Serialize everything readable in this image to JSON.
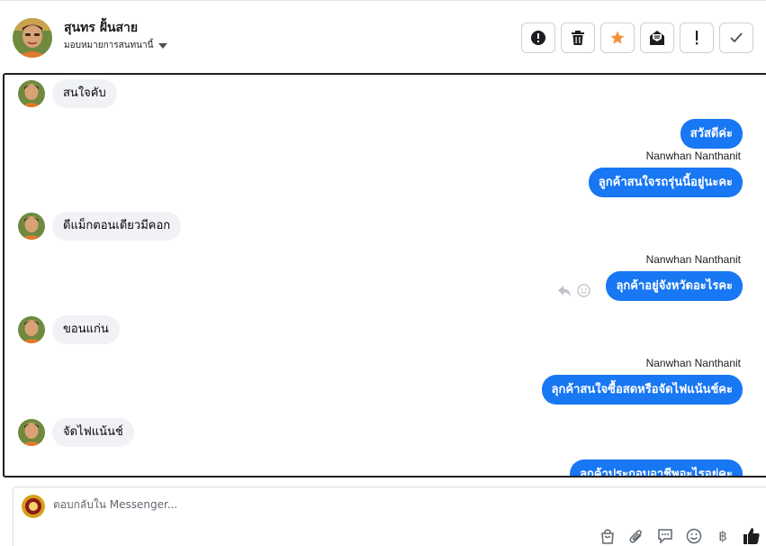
{
  "header": {
    "contact_name": "สุนทร ฝั้นสาย",
    "assign_label": "มอบหมายการสนทนานี้",
    "actions": [
      {
        "name": "spam-button",
        "icon": "alert-circle-icon"
      },
      {
        "name": "delete-button",
        "icon": "trash-icon"
      },
      {
        "name": "star-button",
        "icon": "star-icon"
      },
      {
        "name": "mark-unread-button",
        "icon": "envelope-icon"
      },
      {
        "name": "follow-up-button",
        "icon": "exclamation-icon"
      },
      {
        "name": "done-button",
        "icon": "check-icon"
      }
    ]
  },
  "messages": [
    {
      "dir": "in",
      "text": "สนใจคับ"
    },
    {
      "dir": "out",
      "text": "สวัสดีค่ะ"
    },
    {
      "dir": "out",
      "sender": "Nanwhan Nanthanit",
      "text": "ลูกค้าสนใจรถรุ่นนี้อยู่นะคะ"
    },
    {
      "dir": "in",
      "text": "ดีแม็กตอนเดียวมีคอก"
    },
    {
      "dir": "out",
      "sender": "Nanwhan Nanthanit",
      "text": "ลุกค้าอยู่จังหวัดอะไรคะ"
    },
    {
      "dir": "in",
      "text": "ขอนแก่น"
    },
    {
      "dir": "out",
      "sender": "Nanwhan Nanthanit",
      "text": "ลุกค้าสนใจซื้อสดหรือจัดไฟแน้นช์คะ"
    },
    {
      "dir": "in",
      "text": "จัดไฟแน้นช์"
    },
    {
      "dir": "out",
      "text": "ลุกค้าประกอบอาชีพอะไรอยู่คะ"
    }
  ],
  "reply": {
    "placeholder": "ตอบกลับใน Messenger...",
    "tools": [
      "bag-icon",
      "paperclip-icon",
      "chat-bubble-icon",
      "smiley-icon",
      "baht-icon",
      "thumbs-up-icon"
    ],
    "baht_symbol": "฿"
  },
  "colors": {
    "accent_blue": "#1877f2",
    "star_orange": "#f0923a",
    "incoming_bubble": "#f0f2f5"
  }
}
